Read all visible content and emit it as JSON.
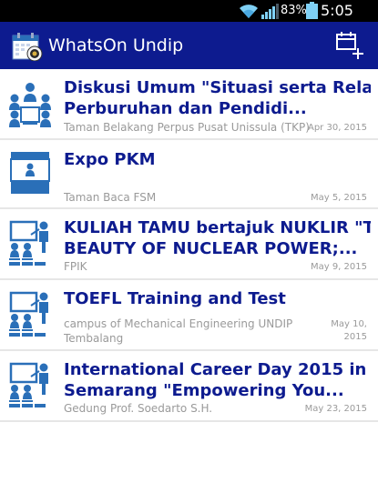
{
  "status_bar": {
    "battery_percent": "83%",
    "time": "5:05 PM",
    "icons": [
      "wifi-icon",
      "signal-icon",
      "battery-icon"
    ]
  },
  "action_bar": {
    "title": "WhatsOn Undip",
    "app_icon": "calendar-logo-icon",
    "action_icon": "add-event-icon"
  },
  "colors": {
    "primary": "#0d1b8f",
    "icon_blue": "#2a6fb8",
    "secondary_text": "#9a9a9a",
    "divider": "#e6e6e6"
  },
  "events": [
    {
      "title_line1": "Diskusi Umum \"Situasi serta Relasi",
      "title_line2": "Perburuhan dan Pendidi...",
      "location": "Taman Belakang Perpus Pusat Unissula (TKP)",
      "date": "Apr 30, 2015",
      "icon": "discussion-group-icon"
    },
    {
      "title_line1": "Expo PKM",
      "title_line2": "",
      "location": "Taman Baca FSM",
      "date": "May 5, 2015",
      "icon": "expo-booth-icon"
    },
    {
      "title_line1": "KULIAH TAMU bertajuk NUKLIR \"THE",
      "title_line2": "BEAUTY OF NUCLEAR POWER;...",
      "location": "FPIK",
      "date": "May 9, 2015",
      "icon": "lecture-icon"
    },
    {
      "title_line1": "TOEFL Training and Test",
      "title_line2": "",
      "location": "campus of Mechanical Engineering UNDIP Tembalang",
      "date": "May 10, 2015",
      "icon": "lecture-icon"
    },
    {
      "title_line1": "International Career Day 2015 in",
      "title_line2": "Semarang \"Empowering You...",
      "location": "Gedung Prof. Soedarto S.H.",
      "date": "May 23, 2015",
      "icon": "lecture-icon"
    }
  ]
}
